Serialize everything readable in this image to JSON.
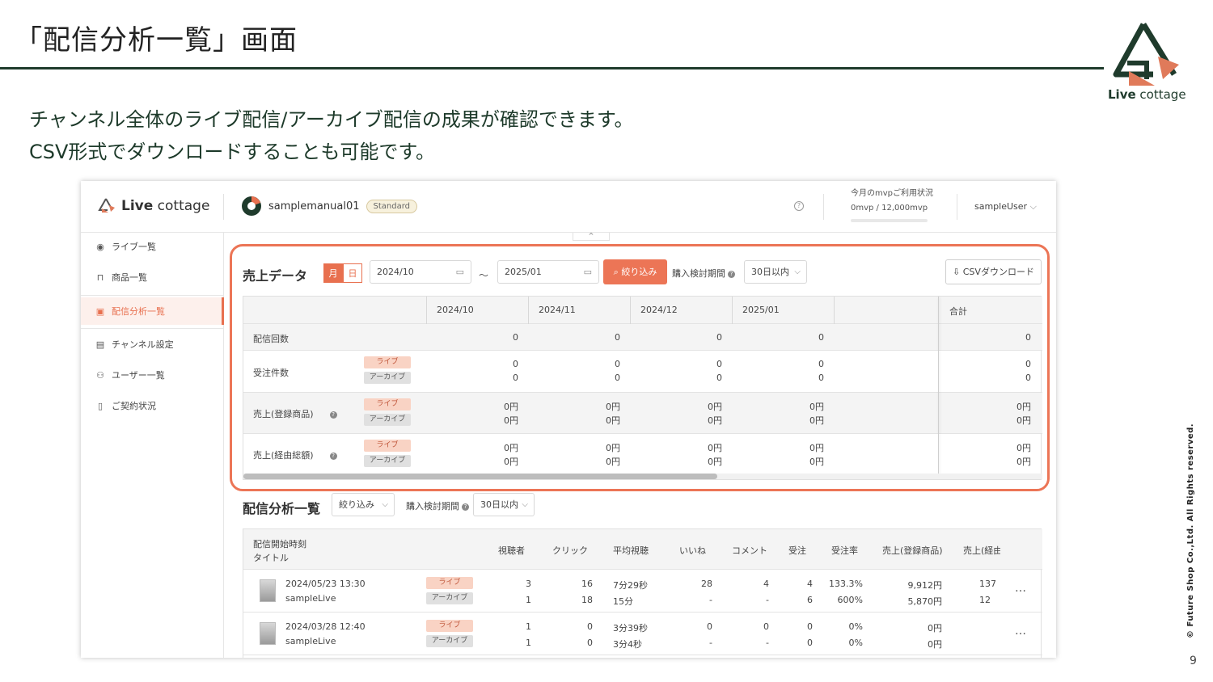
{
  "slide": {
    "title": "「配信分析一覧」画面",
    "description_line1": "チャンネル全体のライブ配信/アーカイブ配信の成果が確認できます。",
    "description_line2": "CSV形式でダウンロードすることも可能です。",
    "logo_bold": "Live",
    "logo_rest": " cottage",
    "copyright": "© Future Shop Co.,Ltd. All Rights reserved.",
    "page_number": "9"
  },
  "colors": {
    "accent": "#ec7556",
    "brand_dark": "#1f3b2c"
  },
  "app": {
    "logo_bold": "Live",
    "logo_rest": " cottage",
    "channel_name": "samplemanual01",
    "plan_badge": "Standard",
    "mvp_label": "今月のmvpご利用状況",
    "mvp_value": "0mvp / 12,000mvp",
    "user_name": "sampleUser",
    "sidebar": [
      {
        "label": "ライブ一覧",
        "icon": "circle-play-icon"
      },
      {
        "label": "商品一覧",
        "icon": "bag-icon"
      },
      {
        "label": "配信分析一覧",
        "icon": "chart-icon"
      },
      {
        "label": "チャンネル設定",
        "icon": "building-icon"
      },
      {
        "label": "ユーザー一覧",
        "icon": "users-icon"
      },
      {
        "label": "ご契約状況",
        "icon": "document-icon"
      }
    ]
  },
  "sales": {
    "title": "売上データ",
    "toggle_month": "月",
    "toggle_day": "日",
    "date_from": "2024/10",
    "date_to": "2025/01",
    "tilde": "〜",
    "filter_button": "絞り込み",
    "period_label": "購入検討期間",
    "period_value": "30日以内",
    "csv_button": "CSVダウンロード",
    "columns": [
      "2024/10",
      "2024/11",
      "2024/12",
      "2025/01"
    ],
    "total_label": "合計",
    "tag_live": "ライブ",
    "tag_archive": "アーカイブ",
    "rows": [
      {
        "label": "配信回数",
        "values": [
          "0",
          "0",
          "0",
          "0"
        ],
        "total": "0"
      },
      {
        "label": "受注件数",
        "live": [
          "0",
          "0",
          "0",
          "0"
        ],
        "archive": [
          "0",
          "0",
          "0",
          "0"
        ],
        "total_live": "0",
        "total_archive": "0"
      },
      {
        "label": "売上(登録商品)",
        "live": [
          "0円",
          "0円",
          "0円",
          "0円"
        ],
        "archive": [
          "0円",
          "0円",
          "0円",
          "0円"
        ],
        "total_live": "0円",
        "total_archive": "0円"
      },
      {
        "label": "売上(経由総額)",
        "live": [
          "0円",
          "0円",
          "0円",
          "0円"
        ],
        "archive": [
          "0円",
          "0円",
          "0円",
          "0円"
        ],
        "total_live": "0円",
        "total_archive": "0円"
      }
    ]
  },
  "analysis": {
    "title": "配信分析一覧",
    "filter_select": "絞り込み",
    "period_label": "購入検討期間",
    "period_value": "30日以内",
    "head_start": "配信開始時刻",
    "head_title": "タイトル",
    "head_cols": [
      "視聴者",
      "クリック",
      "平均視聴",
      "いいね",
      "コメント",
      "受注",
      "受注率",
      "売上(登録商品)",
      "売上(経由"
    ],
    "rows": [
      {
        "datetime": "2024/05/23 13:30",
        "title": "sampleLive",
        "live": [
          "3",
          "16",
          "7分29秒",
          "28",
          "4",
          "4",
          "133.3%",
          "9,912円",
          "137"
        ],
        "archive": [
          "1",
          "18",
          "15分",
          "-",
          "-",
          "6",
          "600%",
          "5,870円",
          "12"
        ]
      },
      {
        "datetime": "2024/03/28 12:40",
        "title": "sampleLive",
        "live": [
          "1",
          "0",
          "3分39秒",
          "0",
          "0",
          "0",
          "0%",
          "0円",
          ""
        ],
        "archive": [
          "1",
          "0",
          "3分4秒",
          "-",
          "-",
          "0",
          "0%",
          "0円",
          ""
        ]
      }
    ],
    "more": "…"
  }
}
